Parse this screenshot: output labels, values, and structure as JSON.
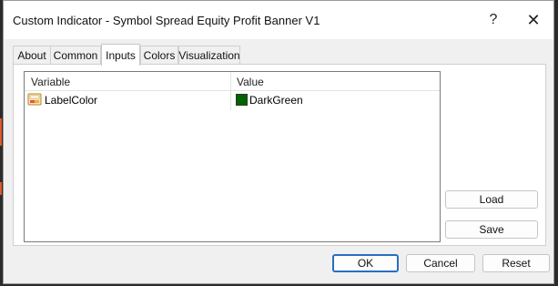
{
  "window": {
    "title": "Custom Indicator - Symbol Spread Equity Profit Banner V1",
    "help_glyph": "?",
    "close_glyph": "✕"
  },
  "tabs": [
    {
      "label": "About"
    },
    {
      "label": "Common"
    },
    {
      "label": "Inputs",
      "active": true
    },
    {
      "label": "Colors"
    },
    {
      "label": "Visualization"
    }
  ],
  "inputs_table": {
    "columns": [
      "Variable",
      "Value"
    ],
    "rows": [
      {
        "variable": "LabelColor",
        "value": "DarkGreen",
        "swatch_color": "#006400",
        "icon": "color-variable-icon"
      }
    ]
  },
  "side_buttons": {
    "load": "Load",
    "save": "Save"
  },
  "footer_buttons": {
    "ok": "OK",
    "cancel": "Cancel",
    "reset": "Reset"
  }
}
